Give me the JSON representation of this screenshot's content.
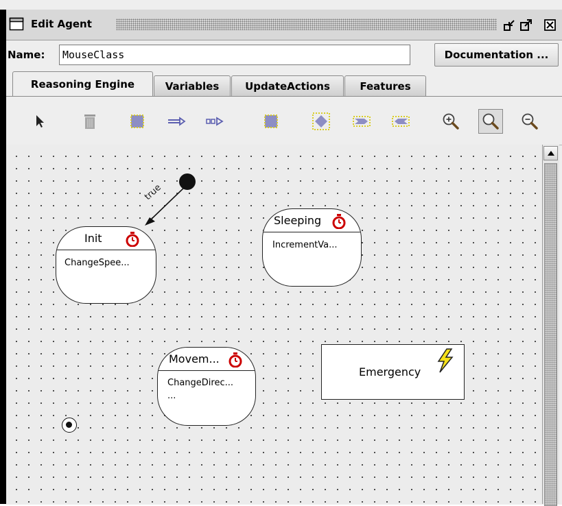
{
  "window": {
    "title": "Edit Agent",
    "icons": [
      "window-icon",
      "minimize-icon",
      "maximize-icon",
      "close-icon"
    ]
  },
  "name_row": {
    "label": "Name:",
    "value": "MouseClass",
    "documentation_button": "Documentation ..."
  },
  "tabs": [
    {
      "label": "Reasoning Engine",
      "active": true
    },
    {
      "label": "Variables",
      "active": false
    },
    {
      "label": "UpdateActions",
      "active": false
    },
    {
      "label": "Features",
      "active": false
    }
  ],
  "toolbar": {
    "tools": [
      "select-arrow-icon",
      "trash-icon",
      "state-icon",
      "transition-icon",
      "dashed-transition-icon",
      "state-alt-icon",
      "choice-icon",
      "fork-icon",
      "join-icon",
      "zoom-in-icon",
      "zoom-reset-icon",
      "zoom-out-icon"
    ],
    "pressed": "zoom-reset-icon"
  },
  "diagram": {
    "states": [
      {
        "name": "Init",
        "action": "ChangeSpee...",
        "has_timer": true
      },
      {
        "name": "Sleeping",
        "action": "IncrementVa...",
        "has_timer": true
      },
      {
        "name": "Movem...",
        "action": "ChangeDirec...",
        "action2": "...",
        "has_timer": true
      }
    ],
    "event": {
      "name": "Emergency",
      "icon": "lightning-icon"
    },
    "transition_label": "true"
  },
  "colors": {
    "timer_red": "#cc0000",
    "bolt_yellow": "#f5e11a"
  }
}
